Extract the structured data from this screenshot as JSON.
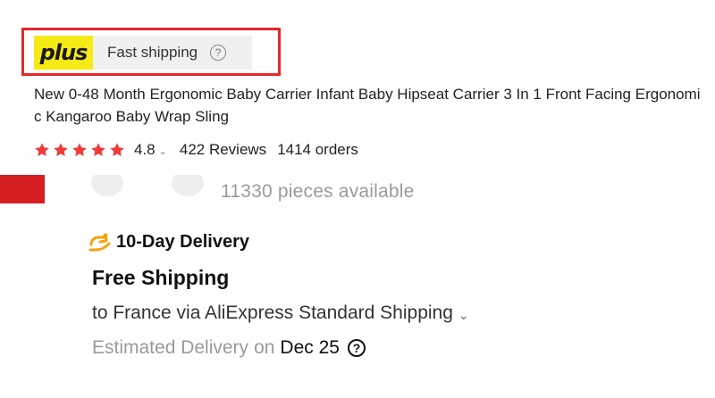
{
  "badge": {
    "plus_text": "plus",
    "label": "Fast shipping",
    "help_glyph": "?",
    "brand_color": "#f5ea16",
    "highlight_color": "#e8262b"
  },
  "product": {
    "title": "New 0-48 Month Ergonomic Baby Carrier Infant Baby Hipseat Carrier 3 In 1 Front Facing Ergonomic Kangaroo Baby Wrap Sling",
    "rating": "4.8",
    "rating_max_stars": 5,
    "rating_chevron": "⌄",
    "reviews": "422 Reviews",
    "orders": "1414 orders",
    "star_color": "#f03a3a"
  },
  "quantity": {
    "available": "11330 pieces available"
  },
  "delivery": {
    "icon": "delivery-hand-icon",
    "title": "10-Day Delivery",
    "shipping_title": "Free Shipping",
    "route": "to France via AliExpress Standard Shipping",
    "route_chevron": "⌄",
    "estimate_label": "Estimated Delivery",
    "estimate_on": "on",
    "estimate_date": "Dec 25",
    "help_glyph": "?"
  }
}
